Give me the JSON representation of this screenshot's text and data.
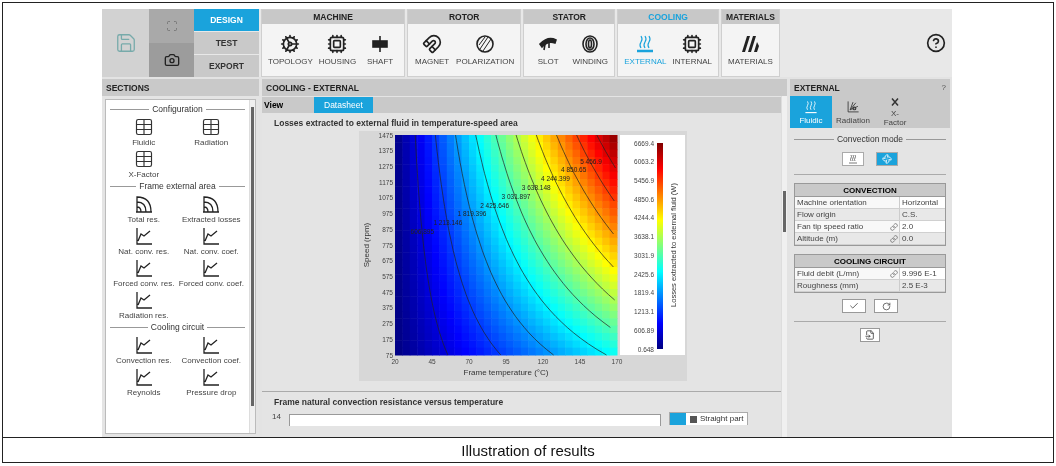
{
  "ribbon": {
    "modes": [
      {
        "label": "DESIGN",
        "selected": true
      },
      {
        "label": "TEST",
        "selected": false
      },
      {
        "label": "EXPORT",
        "selected": false
      }
    ],
    "groups": [
      {
        "title": "MACHINE",
        "active": false,
        "items": [
          {
            "label": "TOPOLOGY",
            "kind": "topology",
            "selected": false
          },
          {
            "label": "HOUSING",
            "kind": "housing",
            "selected": false
          },
          {
            "label": "SHAFT",
            "kind": "shaft",
            "selected": false
          }
        ]
      },
      {
        "title": "ROTOR",
        "active": false,
        "items": [
          {
            "label": "MAGNET",
            "kind": "magnet",
            "selected": false
          },
          {
            "label": "POLARIZATION",
            "kind": "polarization",
            "selected": false
          }
        ]
      },
      {
        "title": "STATOR",
        "active": false,
        "items": [
          {
            "label": "SLOT",
            "kind": "slot",
            "selected": false
          },
          {
            "label": "WINDING",
            "kind": "winding",
            "selected": false
          }
        ]
      },
      {
        "title": "COOLING",
        "active": true,
        "items": [
          {
            "label": "EXTERNAL",
            "kind": "external",
            "selected": true
          },
          {
            "label": "INTERNAL",
            "kind": "internal",
            "selected": false
          }
        ]
      },
      {
        "title": "MATERIALS",
        "active": false,
        "items": [
          {
            "label": "MATERIALS",
            "kind": "materials",
            "selected": false
          }
        ]
      }
    ]
  },
  "sections": {
    "title": "SECTIONS",
    "groups": [
      {
        "title": "Configuration",
        "items": [
          {
            "label": "Fluidic",
            "kind": "table"
          },
          {
            "label": "Radiation",
            "kind": "table"
          },
          {
            "label": "X-Factor",
            "kind": "table"
          }
        ]
      },
      {
        "title": "Frame external area",
        "items": [
          {
            "label": "Total res.",
            "kind": "arcs"
          },
          {
            "label": "Extracted losses",
            "kind": "arcs"
          },
          {
            "label": "Nat. conv. res.",
            "kind": "graph"
          },
          {
            "label": "Nat. conv. coef.",
            "kind": "graph"
          },
          {
            "label": "Forced conv. res.",
            "kind": "graph"
          },
          {
            "label": "Forced conv. coef.",
            "kind": "graph"
          },
          {
            "label": "Radiation res.",
            "kind": "graph"
          }
        ]
      },
      {
        "title": "Cooling circuit",
        "items": [
          {
            "label": "Convection res.",
            "kind": "graph"
          },
          {
            "label": "Convection coef.",
            "kind": "graph"
          },
          {
            "label": "Reynolds",
            "kind": "graph"
          },
          {
            "label": "Pressure drop",
            "kind": "graph"
          }
        ]
      }
    ]
  },
  "main": {
    "title": "COOLING - EXTERNAL",
    "view_label": "View",
    "tabs": [
      {
        "label": "Datasheet",
        "selected": true
      }
    ],
    "plot": {
      "title": "Losses extracted to external fluid in temperature-speed area",
      "xlabel": "Frame temperature (°C)",
      "ylabel": "Speed (rpm)",
      "colorbar_label": "Losses extracted to external fluid (W)",
      "xticks": [
        "20",
        "45",
        "70",
        "95",
        "120",
        "145",
        "170"
      ],
      "yticks": [
        "1475",
        "1375",
        "1275",
        "1175",
        "1075",
        "975",
        "875",
        "775",
        "675",
        "575",
        "475",
        "375",
        "275",
        "175",
        "75"
      ],
      "colorbar_ticks": [
        "6669.4",
        "6063.2",
        "5456.9",
        "4850.6",
        "4244.4",
        "3638.1",
        "3031.9",
        "2425.6",
        "1819.4",
        "1213.1",
        "606.89",
        "0.648"
      ],
      "contour_labels": [
        "606.895",
        "1 213.146",
        "1 819.396",
        "2 425.646",
        "3 031.897",
        "3 638.148",
        "4 244.399",
        "4 850.65",
        "5 456.9"
      ]
    },
    "second_plot": {
      "title": "Frame natural convection resistance versus temperature",
      "ytick": "14",
      "legend": [
        {
          "label": "Straight part",
          "checked": true
        }
      ]
    }
  },
  "external": {
    "title": "EXTERNAL",
    "help": "?",
    "tabs": [
      {
        "label": "Fluidic",
        "kind": "fluidic",
        "selected": true
      },
      {
        "label": "Radiation",
        "kind": "radiation",
        "selected": false
      },
      {
        "label": "X-Factor",
        "kind": "xfactor",
        "selected": false
      }
    ],
    "convection_mode": {
      "title": "Convection mode",
      "options": [
        {
          "kind": "natural",
          "selected": false
        },
        {
          "kind": "forced",
          "selected": true
        }
      ]
    },
    "tables": [
      {
        "title": "CONVECTION",
        "rows": [
          {
            "label": "Machine orientation",
            "value": "Horizontal",
            "linked": false
          },
          {
            "label": "Flow origin",
            "value": "C.S.",
            "linked": false
          },
          {
            "label": "Fan tip speed ratio",
            "value": "2.0",
            "linked": true
          },
          {
            "label": "Altitude (m)",
            "value": "0.0",
            "linked": true
          }
        ]
      },
      {
        "title": "COOLING CIRCUIT",
        "rows": [
          {
            "label": "Fluid debit (L/mn)",
            "value": "9.996 E-1",
            "linked": true
          },
          {
            "label": "Roughness (mm)",
            "value": "2.5 E-3",
            "linked": false
          }
        ]
      }
    ]
  },
  "caption": "Illustration of results"
}
